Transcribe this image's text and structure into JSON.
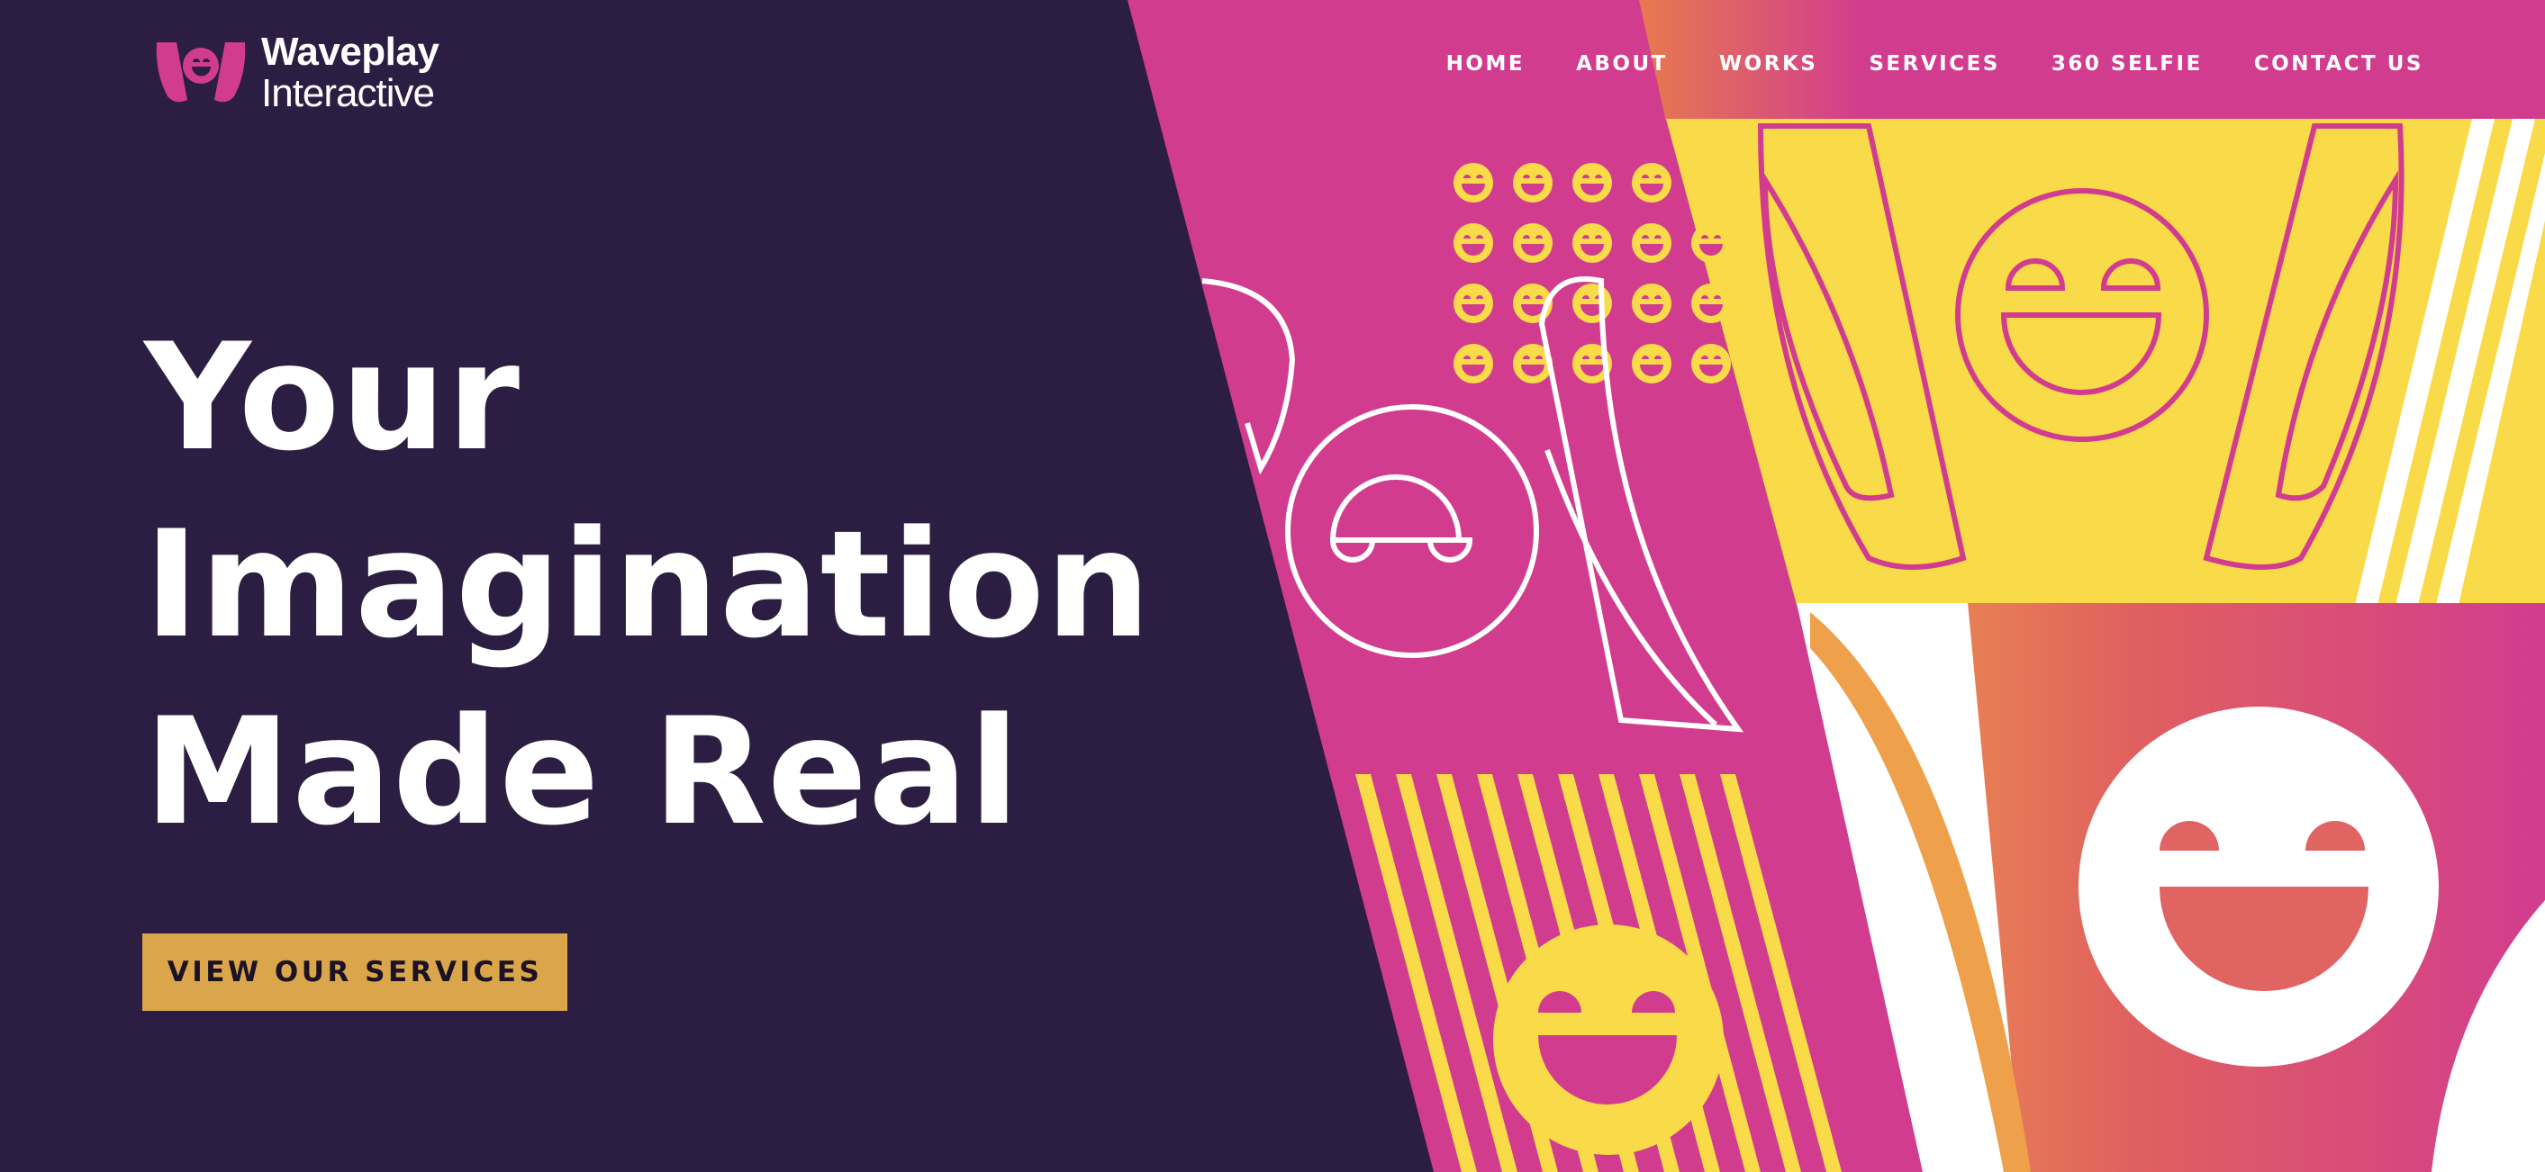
{
  "brand": {
    "name_line1": "Waveplay",
    "name_line2": "Interactive",
    "logo_icon": "waveplay-smiley-logo"
  },
  "nav": {
    "items": [
      {
        "label": "HOME"
      },
      {
        "label": "ABOUT"
      },
      {
        "label": "WORKS"
      },
      {
        "label": "SERVICES"
      },
      {
        "label": "360 SELFIE"
      },
      {
        "label": "CONTACT US"
      }
    ]
  },
  "hero": {
    "line1": "Your",
    "line2": "Imagination",
    "line3": "Made Real",
    "cta_label": "VIEW OUR SERVICES"
  },
  "colors": {
    "background": "#2c1e42",
    "magenta": "#d23c8f",
    "yellow": "#f9da48",
    "orange": "#e98a4c",
    "cta": "#dba64b",
    "text": "#ffffff"
  }
}
